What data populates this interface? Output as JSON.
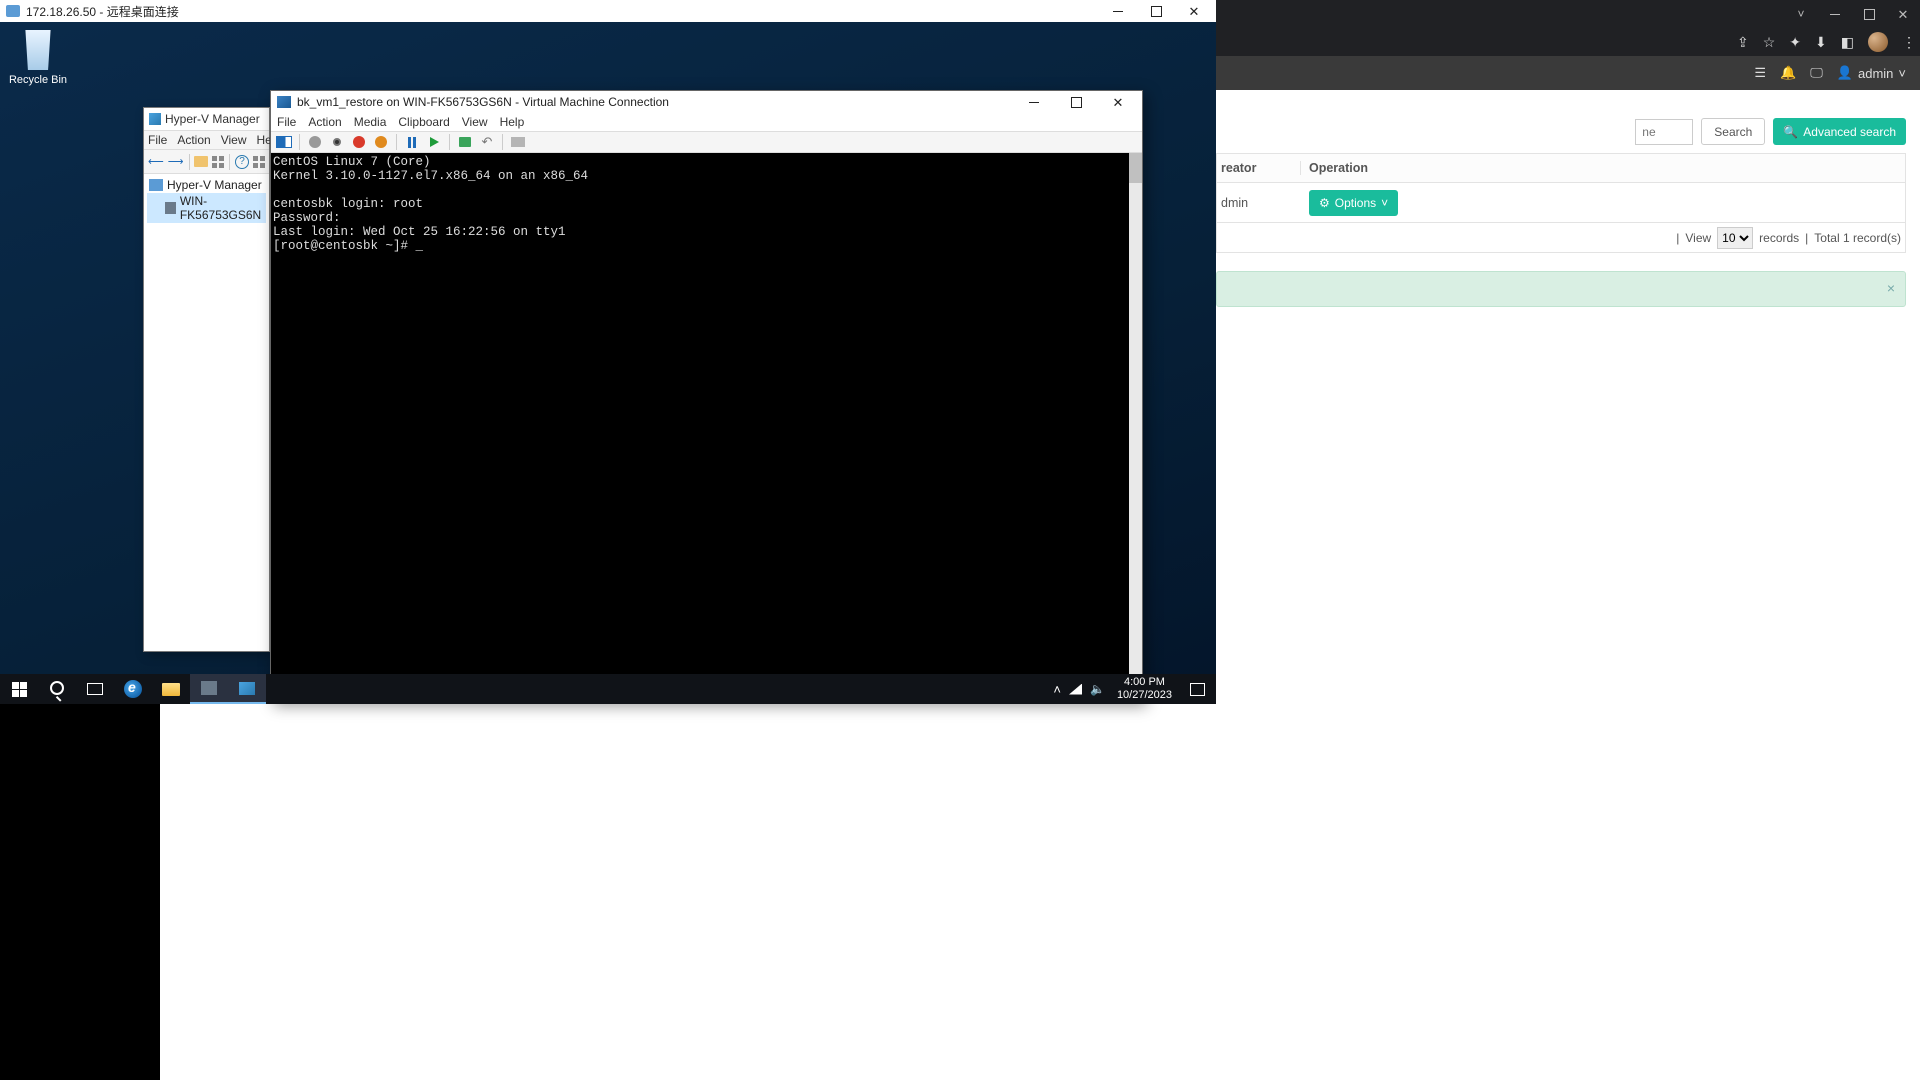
{
  "rdp": {
    "title": "172.18.26.50 - 远程桌面连接",
    "recycle_bin": "Recycle Bin",
    "taskbar": {
      "time": "4:00 PM",
      "date": "10/27/2023"
    }
  },
  "hyperv": {
    "title": "Hyper-V Manager",
    "menu": [
      "File",
      "Action",
      "View",
      "Help"
    ],
    "tree": {
      "root": "Hyper-V Manager",
      "host": "WIN-FK56753GS6N"
    }
  },
  "vmc": {
    "title": "bk_vm1_restore on WIN-FK56753GS6N - Virtual Machine Connection",
    "menu": [
      "File",
      "Action",
      "Media",
      "Clipboard",
      "View",
      "Help"
    ],
    "console_lines": [
      "CentOS Linux 7 (Core)",
      "Kernel 3.10.0-1127.el7.x86_64 on an x86_64",
      "",
      "centosbk login: root",
      "Password:",
      "Last login: Wed Oct 25 16:22:56 on tty1",
      "[root@centosbk ~]# _"
    ]
  },
  "webapp": {
    "user": "admin",
    "search_placeholder": "ne",
    "search_btn": "Search",
    "adv_btn": "Advanced search",
    "columns": {
      "creator": "reator",
      "operation": "Operation"
    },
    "row": {
      "creator": "dmin",
      "options": "Options"
    },
    "pager": {
      "view": "View",
      "per_page": "10",
      "records_label": "records",
      "total": "Total 1 record(s)"
    }
  }
}
